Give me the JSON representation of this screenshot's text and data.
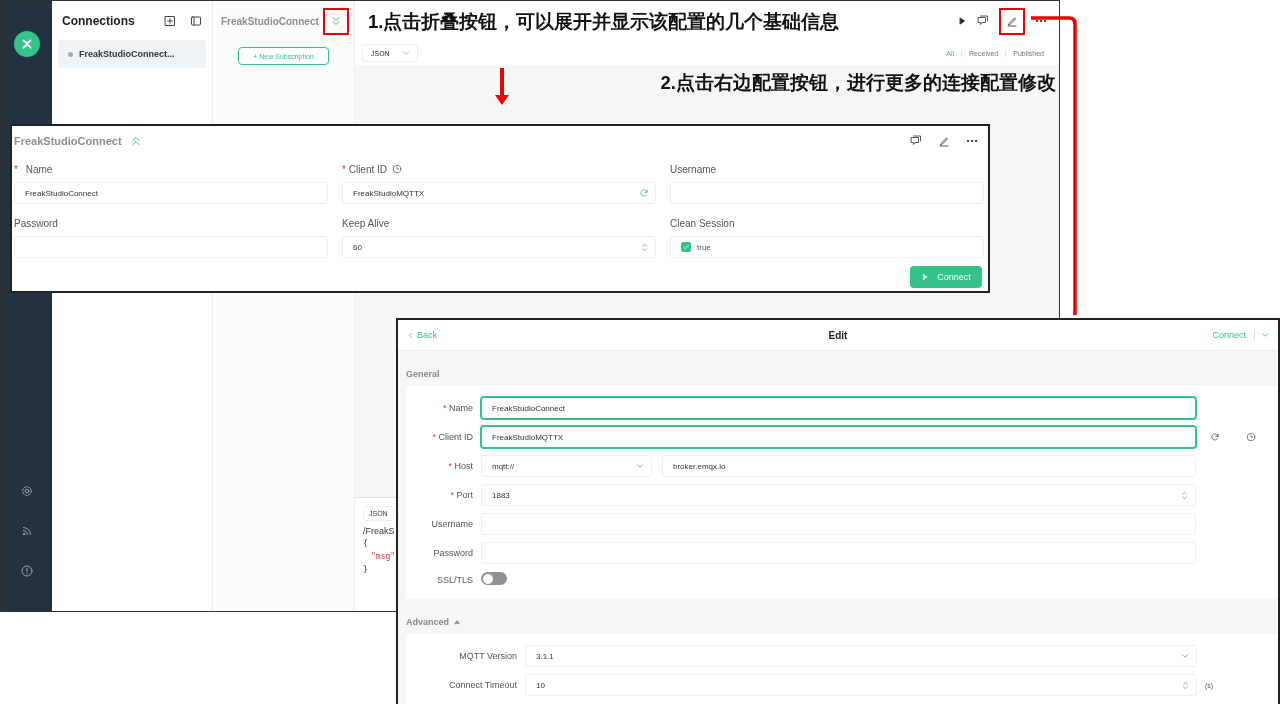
{
  "annotations": [
    {
      "text": "1.点击折叠按钮，可以展开并显示该配置的几个基础信息"
    },
    {
      "text": "2.点击右边配置按钮，进行更多的连接配置修改"
    }
  ],
  "required_mark": "*",
  "app": {
    "connections": {
      "title": "Connections",
      "items": [
        {
          "name": "FreakStudioConnect...",
          "selected": true
        }
      ]
    },
    "subscriptions": {
      "title": "FreakStudioConnect",
      "new_button": "+ New Subscription"
    },
    "messages": {
      "format": "JSON",
      "filters": [
        {
          "label": "All",
          "selected": true
        },
        {
          "label": "Received",
          "selected": false
        },
        {
          "label": "Published",
          "selected": false
        }
      ],
      "composer": {
        "format": "JSON",
        "topic": "/FreakS",
        "payload_lines": [
          {
            "text": "{",
            "kind": "brace"
          },
          {
            "text": "\"msg\"",
            "kind": "key"
          },
          {
            "text": "}",
            "kind": "brace"
          }
        ]
      }
    }
  },
  "quick_config": {
    "title": "FreakStudioConnect",
    "fields": [
      {
        "label": "Name",
        "required": true,
        "kind": "text",
        "value": "FreakStudioConnect"
      },
      {
        "label": "Client ID",
        "required": true,
        "kind": "client_id",
        "value": "FreakStudioMQTTX"
      },
      {
        "label": "Username",
        "required": false,
        "kind": "text"
      },
      {
        "label": "Password",
        "required": false,
        "kind": "text"
      },
      {
        "label": "Keep Alive",
        "required": false,
        "kind": "number",
        "value": "60"
      },
      {
        "label": "Clean Session",
        "required": false,
        "kind": "checkbox",
        "checked": true,
        "value": "true"
      }
    ],
    "connect_button": "Connect"
  },
  "edit": {
    "back": "Back",
    "title": "Edit",
    "connect": "Connect",
    "sections": [
      {
        "title": "General",
        "collapsible": false,
        "fields": [
          {
            "label": "Name",
            "required": true,
            "kind": "text",
            "value": "FreakStudioConnect",
            "active": true
          },
          {
            "label": "Client ID",
            "required": true,
            "kind": "client_id",
            "value": "FreakStudioMQTTX",
            "active": true
          },
          {
            "label": "Host",
            "required": true,
            "kind": "host",
            "protocol": "mqtt://",
            "value": "broker.emqx.io",
            "active": false
          },
          {
            "label": "Port",
            "required": true,
            "kind": "number",
            "value": "1883",
            "active": false
          },
          {
            "label": "Username",
            "required": false,
            "kind": "text",
            "active": false
          },
          {
            "label": "Password",
            "required": false,
            "kind": "text",
            "active": false
          },
          {
            "label": "SSL/TLS",
            "required": false,
            "kind": "toggle",
            "on": false
          }
        ]
      },
      {
        "title": "Advanced",
        "collapsible": true,
        "fields": [
          {
            "label": "MQTT Version",
            "required": false,
            "kind": "select",
            "value": "3.1.1",
            "active": false
          },
          {
            "label": "Connect Timeout",
            "required": false,
            "kind": "number",
            "value": "10",
            "unit": "(s)",
            "active": false
          }
        ]
      }
    ]
  }
}
